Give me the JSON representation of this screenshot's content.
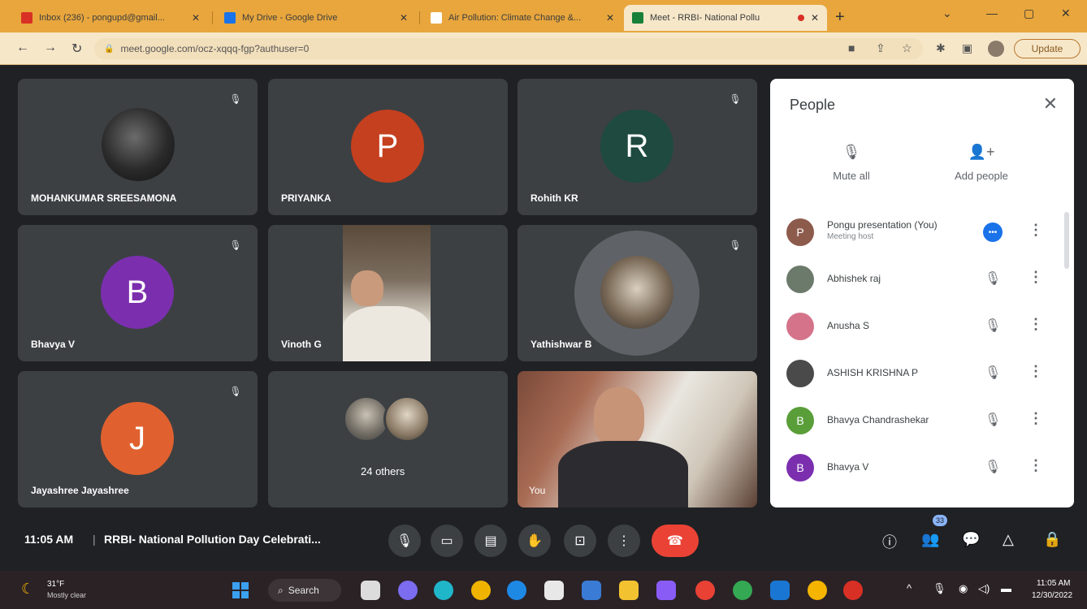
{
  "browser": {
    "tabs": [
      {
        "label": "Inbox (236) - pongupd@gmail...",
        "favicon_color": "#d93025"
      },
      {
        "label": "My Drive - Google Drive",
        "favicon_color": "#1a73e8"
      },
      {
        "label": "Air Pollution: Climate Change &...",
        "favicon_color": "#ffffff"
      },
      {
        "label": "Meet - RRBI- National Pollu",
        "favicon_color": "#188038"
      }
    ],
    "url": "meet.google.com/ocz-xqqq-fgp?authuser=0",
    "update_label": "Update",
    "back_icon": "arrow-left-icon",
    "forward_icon": "arrow-right-icon",
    "reload_icon": "reload-icon"
  },
  "tiles": [
    {
      "name": "MOHANKUMAR SREESAMONA",
      "muted": true
    },
    {
      "name": "PRIYANKA",
      "initial": "P",
      "avatar_color": "#c5401f",
      "muted": false
    },
    {
      "name": "Rohith KR",
      "initial": "R",
      "avatar_color": "#1e4a3f",
      "muted": true
    },
    {
      "name": "Bhavya V",
      "initial": "B",
      "avatar_color": "#7b2fae",
      "muted": true
    },
    {
      "name": "Vinoth G",
      "muted": false
    },
    {
      "name": "Yathishwar B",
      "muted": true
    },
    {
      "name": "Jayashree Jayashree",
      "initial": "J",
      "avatar_color": "#e0612f",
      "muted": true
    },
    {
      "others_label": "24 others"
    },
    {
      "name": "You"
    }
  ],
  "people_panel": {
    "title": "People",
    "mute_all_label": "Mute all",
    "add_people_label": "Add people",
    "participants": [
      {
        "name": "Pongu presentation (You)",
        "role": "Meeting host",
        "initial": "P",
        "color": "#8d5b4c"
      },
      {
        "name": "Abhishek raj",
        "color": "#6c7a6c"
      },
      {
        "name": "Anusha S",
        "color": "#d4738a"
      },
      {
        "name": "ASHISH KRISHNA P",
        "color": "#4a4a4a"
      },
      {
        "name": "Bhavya Chandrashekar",
        "initial": "B",
        "color": "#5a9e3a"
      },
      {
        "name": "Bhavya V",
        "initial": "B",
        "color": "#7b2fae"
      }
    ]
  },
  "controls": {
    "time": "11:05 AM",
    "divider": "|",
    "meeting_title": "RRBI- National Pollution Day Celebrati...",
    "participant_count": "33"
  },
  "taskbar": {
    "temp": "31°F",
    "weather": "Mostly clear",
    "search_label": "Search",
    "clock_time": "11:05 AM",
    "clock_date": "12/30/2022"
  }
}
